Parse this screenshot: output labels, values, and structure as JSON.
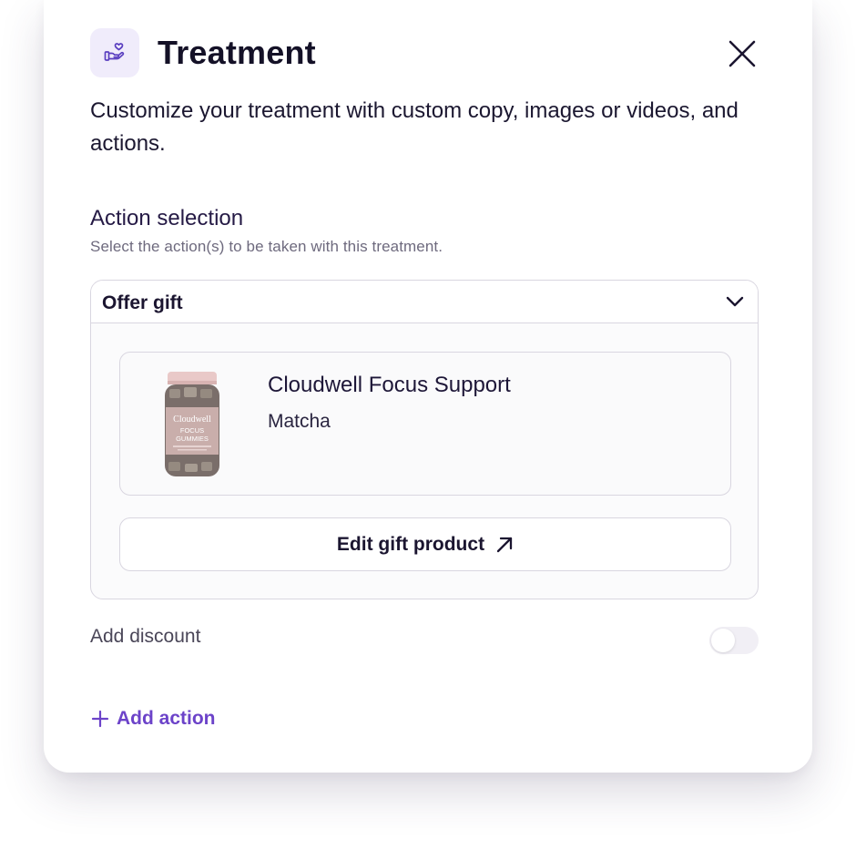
{
  "header": {
    "icon": "gift-hand-icon",
    "title": "Treatment",
    "close_icon": "close-icon"
  },
  "description": "Customize your treatment with custom copy, images or videos, and actions.",
  "action_selection": {
    "title": "Action selection",
    "subtitle": "Select the action(s) to be taken with this treatment.",
    "selected_action": "Offer gift",
    "product": {
      "name": "Cloudwell Focus Support",
      "variant": "Matcha",
      "image_brand": "Cloudwell",
      "image_line1": "FOCUS",
      "image_line2": "GUMMIES"
    },
    "edit_button_label": "Edit gift product"
  },
  "discount": {
    "label": "Add discount",
    "enabled": false
  },
  "add_action_label": "Add action",
  "colors": {
    "accent": "#6c43c9",
    "icon_bg": "#f0ecfb",
    "border": "#d9d6e0"
  }
}
